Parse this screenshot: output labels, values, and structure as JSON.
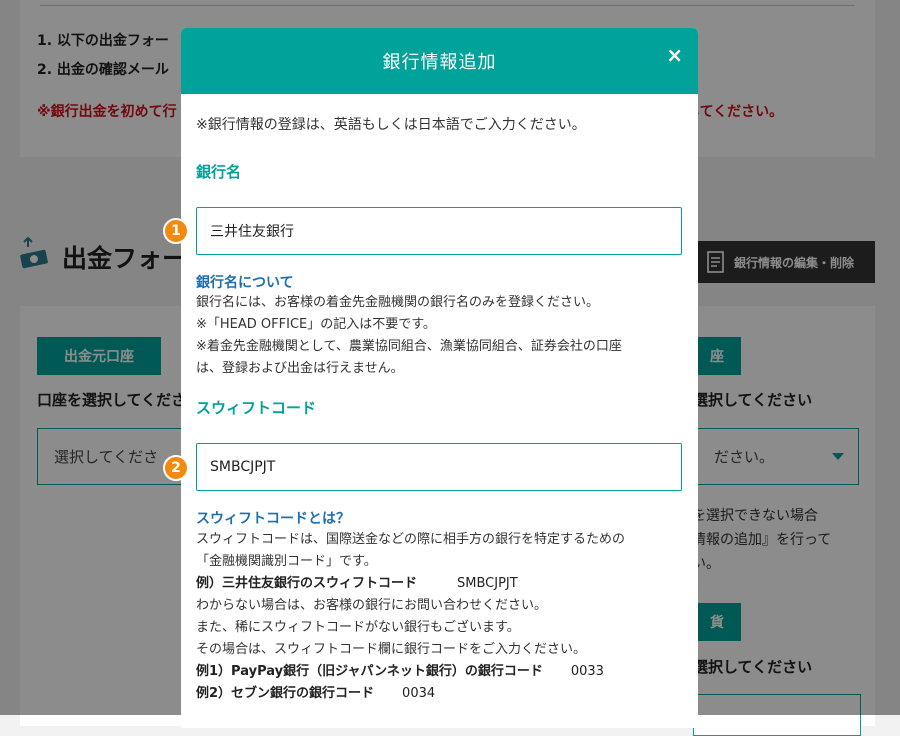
{
  "background": {
    "instructions": [
      "1. 以下の出金フォー",
      "2. 出金の確認メール"
    ],
    "warning_left": "※銀行出金を初めて行",
    "warning_right": "録してください。",
    "section_title": "出金フォー",
    "edit_button_label": "銀行情報の編集・削除",
    "source_account_tag": "出金元口座",
    "right_tag": "座",
    "right_tag_2": "貨",
    "select_prompt_left": "口座を選択してくださ",
    "select_prompt_right": "選択してください",
    "select_prompt_right_2": "選択してください",
    "select_placeholder_left": "選択してくださ",
    "select_placeholder_right": "ださい。",
    "help_lines": [
      "を選択できない場合",
      "情報の追加』を行って",
      "い。"
    ]
  },
  "modal": {
    "title": "銀行情報追加",
    "close_label": "×",
    "intro": "※銀行情報の登録は、英語もしくは日本語でご入力ください。",
    "bank_name": {
      "label": "銀行名",
      "value": "三井住友銀行",
      "badge": "1",
      "info_title": "銀行名について",
      "info_lines": [
        "銀行名には、お客様の着金先金融機関の銀行名のみを登録ください。",
        "※「HEAD OFFICE」の記入は不要です。",
        "※着金先金融機関として、農業協同組合、漁業協同組合、証券会社の口座",
        "は、登録および出金は行えません。"
      ]
    },
    "swift": {
      "label": "スウィフトコード",
      "value": "SMBCJPJT",
      "badge": "2",
      "info_title": "スウィフトコードとは？",
      "info_lines": [
        "スウィフトコードは、国際送金などの際に相手方の銀行を特定するための",
        "「金融機関識別コード」です。"
      ],
      "example_label": "例）三井住友銀行のスウィフトコード",
      "example_value": "SMBCJPJT",
      "more_lines": [
        "わからない場合は、お客様の銀行にお問い合わせください。",
        "また、稀にスウィフトコードがない銀行もございます。",
        "その場合は、スウィフトコード欄に銀行コードをご入力ください。"
      ],
      "example1_label": "例1）PayPay銀行（旧ジャパンネット銀行）の銀行コード",
      "example1_value": "0033",
      "example2_label": "例2）セブン銀行の銀行コード",
      "example2_value": "0034"
    }
  },
  "colors": {
    "accent": "#00a29a",
    "badge": "#f28a10",
    "warning": "#d0121b",
    "info_title": "#1f6fb0"
  }
}
